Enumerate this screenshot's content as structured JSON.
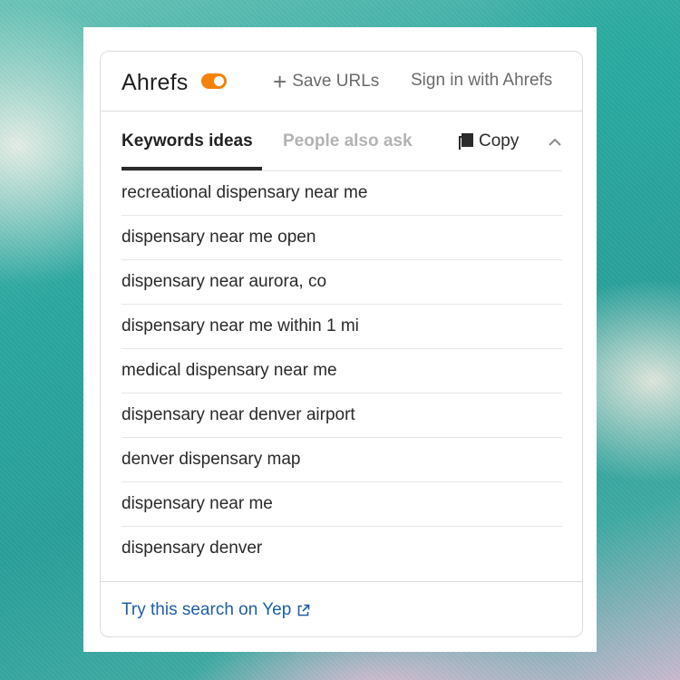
{
  "header": {
    "brand": "Ahrefs",
    "toggle_on": true,
    "save_urls_label": "Save URLs",
    "sign_in_label": "Sign in with Ahrefs"
  },
  "tabs": [
    {
      "label": "Keywords ideas",
      "active": true
    },
    {
      "label": "People also ask",
      "active": false
    }
  ],
  "toolbar": {
    "copy_label": "Copy"
  },
  "keywords": [
    "recreational dispensary near me",
    "dispensary near me open",
    "dispensary near aurora, co",
    "dispensary near me within 1 mi",
    "medical dispensary near me",
    "dispensary near denver airport",
    "denver dispensary map",
    "dispensary near me",
    "dispensary denver"
  ],
  "footer": {
    "link_label": "Try this search on Yep"
  },
  "icons": {
    "plus": "plus-icon",
    "copy": "copy-icon",
    "collapse": "chevron-up-icon",
    "external": "external-link-icon"
  },
  "colors": {
    "toggle": "#f4820a",
    "link": "#1f5fa8",
    "active_tab": "#222222",
    "inactive_tab": "#b3b3b3"
  }
}
